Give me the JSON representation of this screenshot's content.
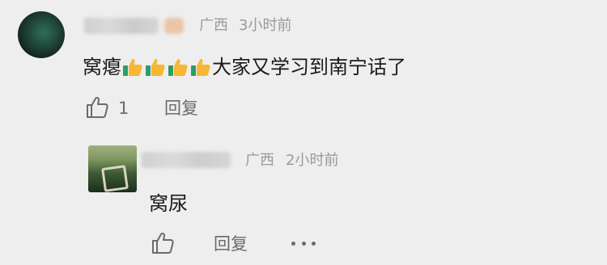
{
  "comment": {
    "region": "广西",
    "time": "3小时前",
    "text_before": "窝瘪",
    "thumbs": [
      "thumbs-up-emoji",
      "thumbs-up-emoji",
      "thumbs-up-emoji",
      "thumbs-up-emoji"
    ],
    "text_after": "大家又学习到南宁话了",
    "like_count": "1",
    "reply_label": "回复"
  },
  "reply": {
    "region": "广西",
    "time": "2小时前",
    "text": "窝尿",
    "reply_label": "回复"
  },
  "icons": {
    "like": "thumb-up-outline-icon",
    "more": "more-dots-icon"
  }
}
